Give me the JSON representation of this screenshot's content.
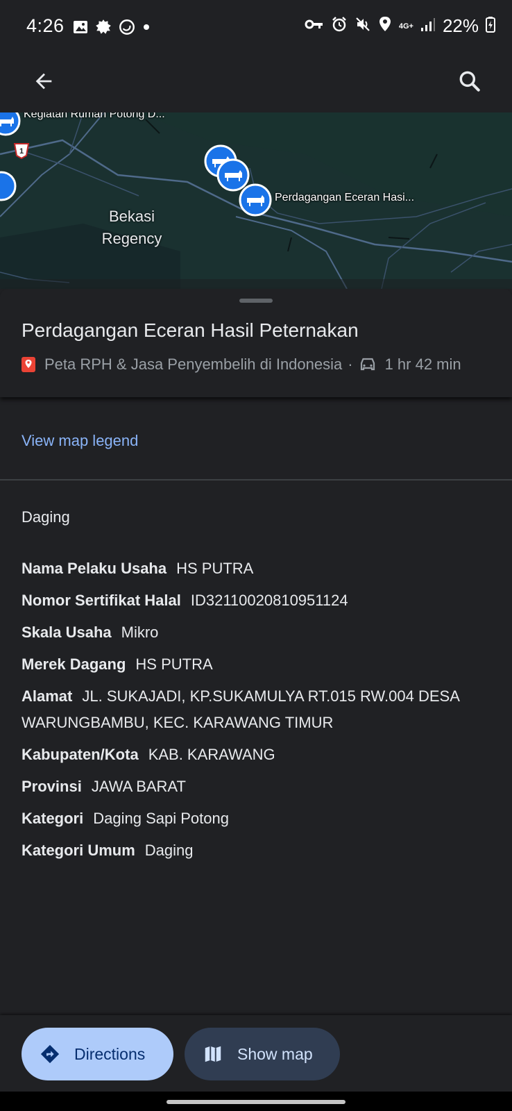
{
  "status_bar": {
    "time": "4:26",
    "network": "4G+",
    "battery": "22%"
  },
  "map": {
    "region_label": "Bekasi\nRegency",
    "pin_label_main": "Perdagangan Eceran Hasi...",
    "pin_label_top": "Kegiatan Rumah Potong D...",
    "road_shield": "1"
  },
  "place": {
    "title": "Perdagangan Eceran Hasil Peternakan",
    "list_name": "Peta RPH & Jasa Penyembelih di Indonesia",
    "separator": "·",
    "drive_time": "1 hr 42 min"
  },
  "legend": {
    "link_label": "View map legend"
  },
  "details": {
    "section_title": "Daging",
    "attributes": [
      {
        "key": "Nama Pelaku Usaha",
        "value": "HS PUTRA"
      },
      {
        "key": "Nomor Sertifikat Halal",
        "value": "ID32110020810951124"
      },
      {
        "key": "Skala Usaha",
        "value": "Mikro"
      },
      {
        "key": "Merek Dagang",
        "value": "HS PUTRA"
      },
      {
        "key": "Alamat",
        "value": "JL. SUKAJADI, KP.SUKAMULYA RT.015 RW.004 DESA WARUNGBAMBU, KEC. KARAWANG TIMUR"
      },
      {
        "key": "Kabupaten/Kota",
        "value": "KAB. KARAWANG"
      },
      {
        "key": "Provinsi",
        "value": "JAWA BARAT"
      },
      {
        "key": "Kategori",
        "value": "Daging Sapi Potong"
      },
      {
        "key": "Kategori Umum",
        "value": "Daging"
      }
    ]
  },
  "actions": {
    "directions_label": "Directions",
    "show_map_label": "Show map"
  },
  "colors": {
    "background": "#202124",
    "link": "#8ab4f8",
    "directions_bg": "#aecbfa",
    "show_map_bg": "#303d52",
    "pin": "#1a73e8",
    "list_icon": "#ea4335"
  }
}
